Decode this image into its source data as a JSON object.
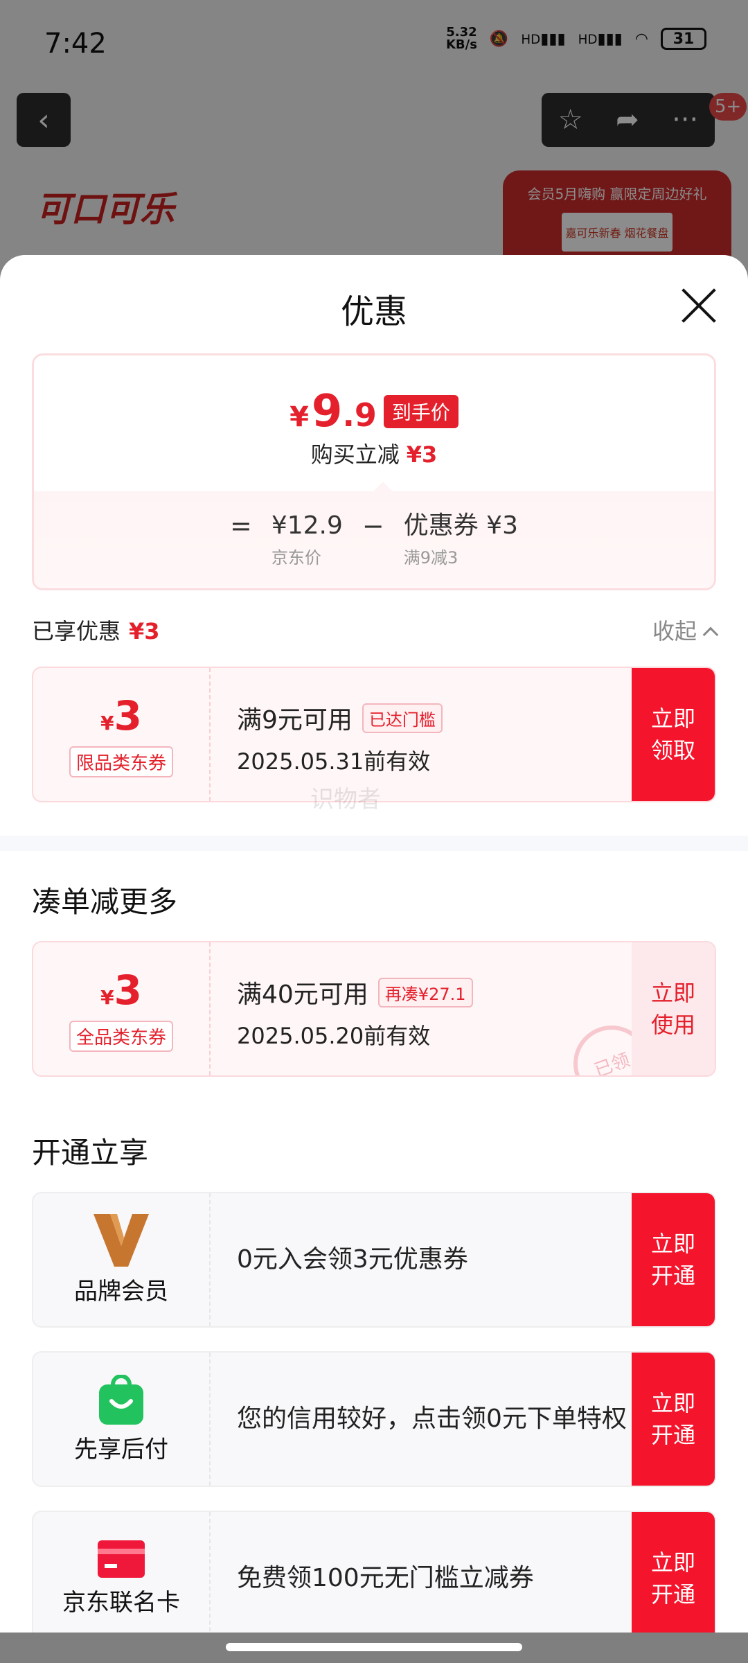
{
  "status_bar": {
    "time": "7:42",
    "net_speed_value": "5.32",
    "net_speed_unit": "KB/s",
    "signal1": "HD",
    "signal2": "HD",
    "battery": "31"
  },
  "background_page": {
    "notification_badge": "5+",
    "brand_logo_text": "可口可乐",
    "promo_banner_text": "会员5月嗨购 赢限定周边好礼",
    "promo_banner_sub": "嘉可乐新春 烟花餐盘"
  },
  "sheet": {
    "title": "优惠",
    "price_summary": {
      "final_price_symbol": "¥",
      "final_price_int": "9",
      "final_price_dec": ".9",
      "final_price_tag": "到手价",
      "reduce_label": "购买立减",
      "reduce_amount": "¥3",
      "equals": "=",
      "jd_price": "¥12.9",
      "jd_price_label": "京东价",
      "minus": "−",
      "coupon_value": "优惠券 ¥3",
      "coupon_rule": "满9减3"
    },
    "enjoyed": {
      "label": "已享优惠",
      "amount": "¥3",
      "collapse_label": "收起"
    },
    "coupons_enjoyed": [
      {
        "symbol": "¥",
        "amount": "3",
        "type": "限品类东券",
        "condition": "满9元可用",
        "tag": "已达门槛",
        "expiry": "2025.05.31前有效",
        "button": "立即领取"
      }
    ],
    "watermark": "识物者",
    "more_section": {
      "title": "凑单减更多",
      "coupons": [
        {
          "symbol": "¥",
          "amount": "3",
          "type": "全品类东券",
          "condition": "满40元可用",
          "tag": "再凑¥27.1",
          "expiry": "2025.05.20前有效",
          "button": "立即使用",
          "stamp": "已领"
        }
      ]
    },
    "open_section": {
      "title": "开通立享",
      "services": [
        {
          "name": "品牌会员",
          "icon": "brand-member-v-icon",
          "desc": "0元入会领3元优惠券",
          "button": "立即开通",
          "color": "#c7762f"
        },
        {
          "name": "先享后付",
          "icon": "shopping-bag-smile-icon",
          "desc": "您的信用较好，点击领0元下单特权",
          "button": "立即开通",
          "color": "#22c35e"
        },
        {
          "name": "京东联名卡",
          "icon": "credit-card-icon",
          "desc": "免费领100元无门槛立减券",
          "button": "立即开通",
          "color": "#f0183a"
        }
      ]
    }
  },
  "colors": {
    "accent_red": "#f4142c",
    "price_red": "#e4202c",
    "coupon_bg": "#fff6f7"
  }
}
